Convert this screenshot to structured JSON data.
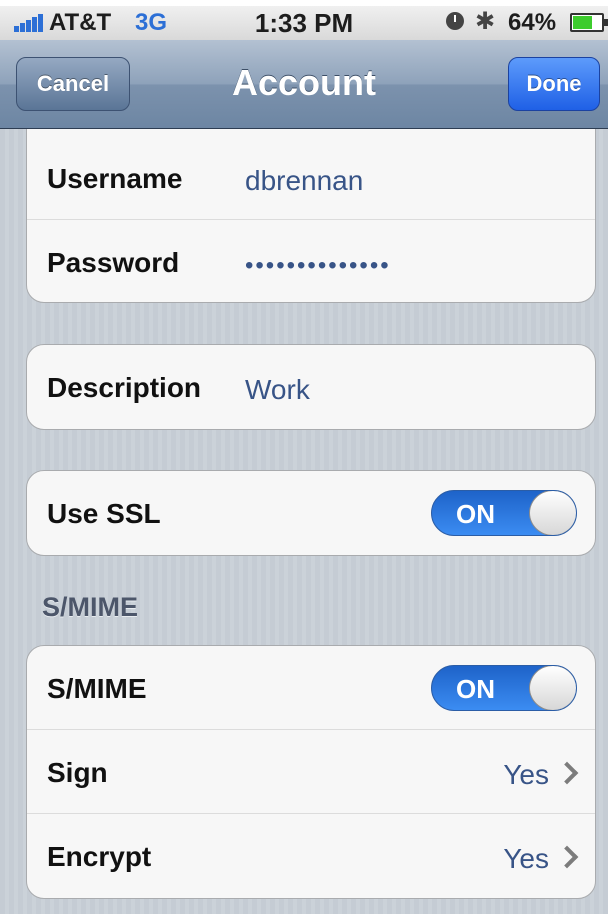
{
  "status_bar": {
    "carrier": "AT&T",
    "network": "3G",
    "time": "1:33 PM",
    "battery_percent": "64%",
    "icons": [
      "signal-icon",
      "clock-lock-icon",
      "bluetooth-icon",
      "battery-icon"
    ]
  },
  "nav": {
    "title": "Account",
    "cancel_label": "Cancel",
    "done_label": "Done"
  },
  "account": {
    "username_label": "Username",
    "username_value": "dbrennan",
    "password_label": "Password",
    "password_value": "••••••••••••••"
  },
  "description": {
    "label": "Description",
    "value": "Work"
  },
  "ssl": {
    "label": "Use SSL",
    "toggle": "ON"
  },
  "smime_section": {
    "header": "S/MIME",
    "smime_label": "S/MIME",
    "smime_toggle": "ON",
    "sign_label": "Sign",
    "sign_value": "Yes",
    "encrypt_label": "Encrypt",
    "encrypt_value": "Yes"
  },
  "colors": {
    "accent_blue": "#2c6fd6",
    "value_text": "#385487"
  }
}
